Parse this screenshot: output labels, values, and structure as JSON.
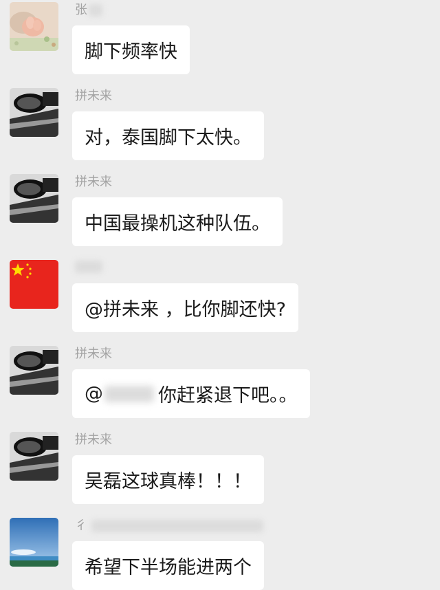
{
  "messages": [
    {
      "name": "张",
      "text": "脚下频率快",
      "avatar_icon": "baby-avatar-icon"
    },
    {
      "name": "拼未来",
      "text": "对，泰国脚下太快。",
      "avatar_icon": "car-mirror-avatar-icon"
    },
    {
      "name": "拼未来",
      "text": "中国最操机这种队伍。",
      "avatar_icon": "car-mirror-avatar-icon"
    },
    {
      "name": "",
      "text": "@拼未来 ，比你脚还快?",
      "avatar_icon": "china-flag-avatar-icon"
    },
    {
      "name": "拼未来",
      "text_prefix": "@",
      "text": "你赶紧退下吧。。",
      "avatar_icon": "car-mirror-avatar-icon"
    },
    {
      "name": "拼未来",
      "text": "吴磊这球真棒！！！",
      "avatar_icon": "car-mirror-avatar-icon"
    },
    {
      "name": "彳",
      "text": "希望下半场能进两个",
      "avatar_icon": "sky-landscape-avatar-icon"
    }
  ],
  "colors": {
    "background": "#ededed",
    "bubble": "#ffffff",
    "name_text": "#a3a3a3",
    "message_text": "#1a1a1a"
  }
}
